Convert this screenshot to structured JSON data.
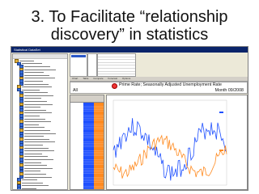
{
  "slide": {
    "title_line1": "3. To Facilitate “relationship",
    "title_line2": "discovery” in statistics"
  },
  "app": {
    "window_title": "Statistical DataSet"
  },
  "chart_header": {
    "title": "Prime Rate; Seasonally Adjusted Unemployment Rate",
    "scope": "All",
    "period": "Month 09/2008"
  },
  "toolbar": {
    "items": [
      "Chart",
      "Table",
      "Compare",
      "Forecast",
      "Options"
    ]
  },
  "colors": {
    "series1": "#1f50ff",
    "series2": "#ff8a1f",
    "titlebar": "#0a246a"
  }
}
